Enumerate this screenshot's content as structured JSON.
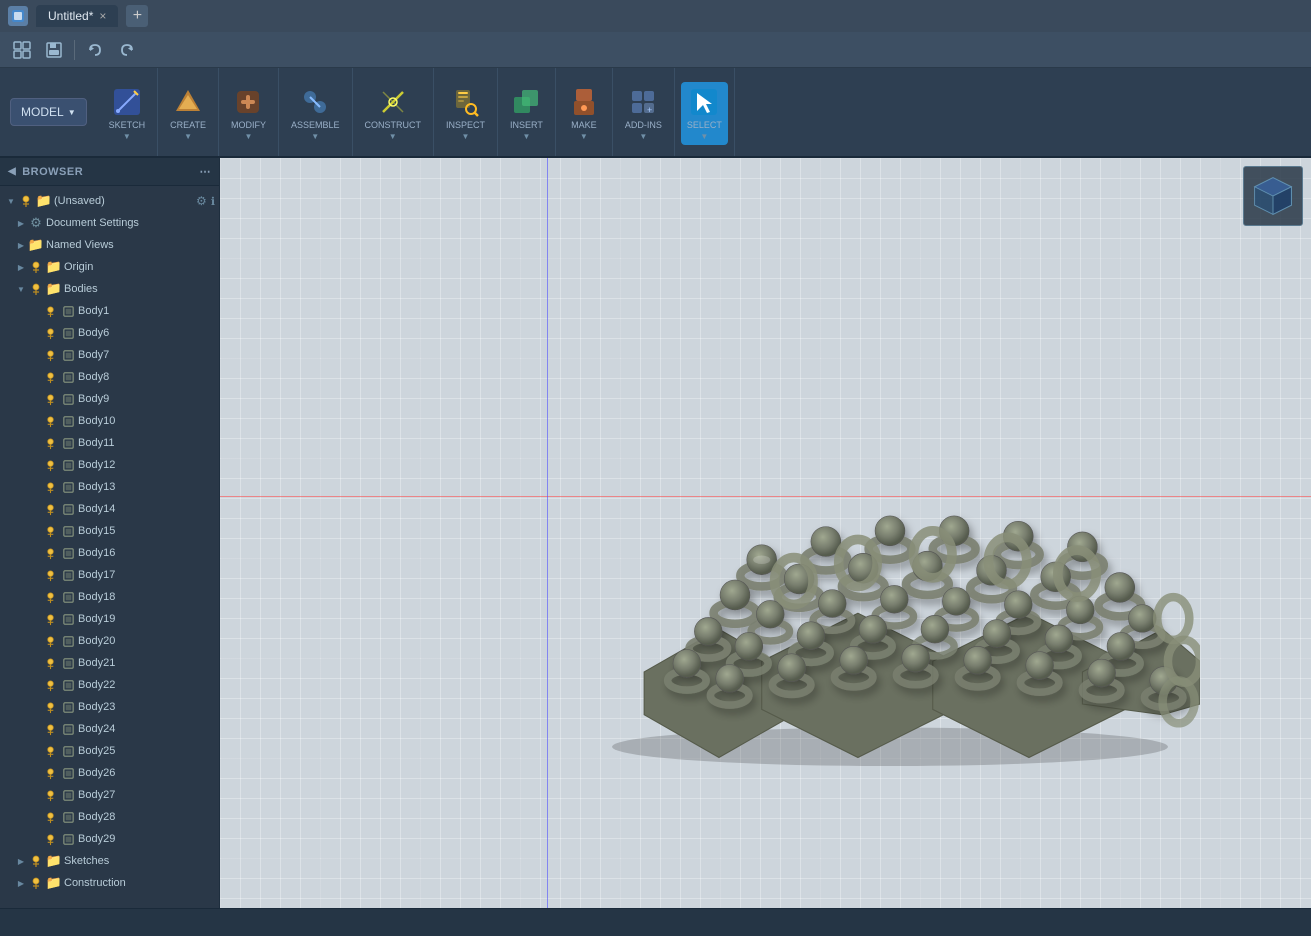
{
  "app": {
    "title": "Untitled*",
    "close_label": "×",
    "new_tab_label": "+"
  },
  "quick_toolbar": {
    "buttons": [
      {
        "name": "grid-button",
        "icon": "⊞",
        "tooltip": "Grid"
      },
      {
        "name": "save-button",
        "icon": "💾",
        "tooltip": "Save"
      },
      {
        "name": "undo-button",
        "icon": "↩",
        "tooltip": "Undo"
      },
      {
        "name": "redo-button",
        "icon": "↪",
        "tooltip": "Redo"
      }
    ]
  },
  "ribbon": {
    "model_label": "MODEL",
    "sections": [
      {
        "name": "sketch",
        "label": "SKETCH",
        "icon": "✏️",
        "has_dropdown": true
      },
      {
        "name": "create",
        "label": "CREATE",
        "icon": "🔷",
        "has_dropdown": true
      },
      {
        "name": "modify",
        "label": "MODIFY",
        "icon": "⚙",
        "has_dropdown": true
      },
      {
        "name": "assemble",
        "label": "ASSEMBLE",
        "icon": "🔗",
        "has_dropdown": true
      },
      {
        "name": "construct",
        "label": "CONSTRUCT",
        "icon": "📐",
        "has_dropdown": true
      },
      {
        "name": "inspect",
        "label": "INSPECT",
        "icon": "🔍",
        "has_dropdown": true
      },
      {
        "name": "insert",
        "label": "INSERT",
        "icon": "📥",
        "has_dropdown": true
      },
      {
        "name": "make",
        "label": "MAKE",
        "icon": "🖨",
        "has_dropdown": true
      },
      {
        "name": "add-ins",
        "label": "ADD-INS",
        "icon": "🔌",
        "has_dropdown": true
      },
      {
        "name": "select",
        "label": "SELECT",
        "icon": "↖",
        "has_dropdown": true,
        "active": true
      }
    ]
  },
  "browser": {
    "header": "BROWSER",
    "tree": [
      {
        "id": "root",
        "label": "(Unsaved)",
        "indent": 0,
        "type": "root",
        "expanded": true,
        "has_settings": true
      },
      {
        "id": "doc-settings",
        "label": "Document Settings",
        "indent": 1,
        "type": "settings",
        "has_arrow": true
      },
      {
        "id": "named-views",
        "label": "Named Views",
        "indent": 1,
        "type": "folder",
        "has_arrow": true
      },
      {
        "id": "origin",
        "label": "Origin",
        "indent": 1,
        "type": "origin",
        "has_arrow": true
      },
      {
        "id": "bodies",
        "label": "Bodies",
        "indent": 1,
        "type": "folder",
        "has_arrow": true,
        "expanded": true
      },
      {
        "id": "body1",
        "label": "Body1",
        "indent": 2,
        "type": "body"
      },
      {
        "id": "body6",
        "label": "Body6",
        "indent": 2,
        "type": "body"
      },
      {
        "id": "body7",
        "label": "Body7",
        "indent": 2,
        "type": "body"
      },
      {
        "id": "body8",
        "label": "Body8",
        "indent": 2,
        "type": "body"
      },
      {
        "id": "body9",
        "label": "Body9",
        "indent": 2,
        "type": "body"
      },
      {
        "id": "body10",
        "label": "Body10",
        "indent": 2,
        "type": "body"
      },
      {
        "id": "body11",
        "label": "Body11",
        "indent": 2,
        "type": "body"
      },
      {
        "id": "body12",
        "label": "Body12",
        "indent": 2,
        "type": "body"
      },
      {
        "id": "body13",
        "label": "Body13",
        "indent": 2,
        "type": "body"
      },
      {
        "id": "body14",
        "label": "Body14",
        "indent": 2,
        "type": "body"
      },
      {
        "id": "body15",
        "label": "Body15",
        "indent": 2,
        "type": "body"
      },
      {
        "id": "body16",
        "label": "Body16",
        "indent": 2,
        "type": "body"
      },
      {
        "id": "body17",
        "label": "Body17",
        "indent": 2,
        "type": "body"
      },
      {
        "id": "body18",
        "label": "Body18",
        "indent": 2,
        "type": "body"
      },
      {
        "id": "body19",
        "label": "Body19",
        "indent": 2,
        "type": "body"
      },
      {
        "id": "body20",
        "label": "Body20",
        "indent": 2,
        "type": "body"
      },
      {
        "id": "body21",
        "label": "Body21",
        "indent": 2,
        "type": "body"
      },
      {
        "id": "body22",
        "label": "Body22",
        "indent": 2,
        "type": "body"
      },
      {
        "id": "body23",
        "label": "Body23",
        "indent": 2,
        "type": "body"
      },
      {
        "id": "body24",
        "label": "Body24",
        "indent": 2,
        "type": "body"
      },
      {
        "id": "body25",
        "label": "Body25",
        "indent": 2,
        "type": "body"
      },
      {
        "id": "body26",
        "label": "Body26",
        "indent": 2,
        "type": "body"
      },
      {
        "id": "body27",
        "label": "Body27",
        "indent": 2,
        "type": "body"
      },
      {
        "id": "body28",
        "label": "Body28",
        "indent": 2,
        "type": "body"
      },
      {
        "id": "body29",
        "label": "Body29",
        "indent": 2,
        "type": "body"
      },
      {
        "id": "sketches",
        "label": "Sketches",
        "indent": 1,
        "type": "folder",
        "has_arrow": true
      },
      {
        "id": "construction",
        "label": "Construction",
        "indent": 1,
        "type": "folder",
        "has_arrow": true
      }
    ]
  },
  "status_bar": {
    "text": ""
  },
  "viewport": {
    "model_description": "3D chain mail / riveted metal sheet assembly"
  }
}
